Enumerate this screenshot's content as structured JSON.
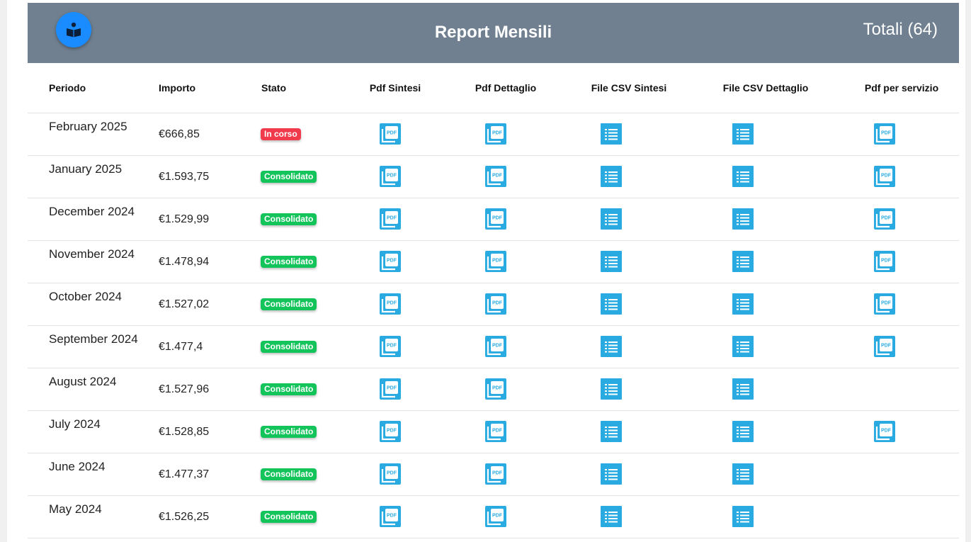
{
  "header": {
    "title": "Report Mensili",
    "totals": "Totali (64)",
    "logo_icon": "reader-book-icon",
    "color": "#708090"
  },
  "columns": {
    "period": "Periodo",
    "amount": "Importo",
    "status": "Stato",
    "pdf_summary": "Pdf Sintesi",
    "pdf_detail": "Pdf Dettaglio",
    "csv_summary": "File CSV Sintesi",
    "csv_detail": "File CSV Dettaglio",
    "pdf_service": "Pdf per servizio"
  },
  "icons": {
    "pdf": "pdf-file-icon",
    "csv": "list-file-icon",
    "color": "#29abe2"
  },
  "status_colors": {
    "In corso": "#f23a4d",
    "Consolidato": "#13c45a"
  },
  "rows": [
    {
      "period": "February 2025",
      "amount": "€666,85",
      "status": "In corso",
      "pdf_service": true
    },
    {
      "period": "January 2025",
      "amount": "€1.593,75",
      "status": "Consolidato",
      "pdf_service": true
    },
    {
      "period": "December 2024",
      "amount": "€1.529,99",
      "status": "Consolidato",
      "pdf_service": true
    },
    {
      "period": "November 2024",
      "amount": "€1.478,94",
      "status": "Consolidato",
      "pdf_service": true
    },
    {
      "period": "October 2024",
      "amount": "€1.527,02",
      "status": "Consolidato",
      "pdf_service": true
    },
    {
      "period": "September 2024",
      "amount": "€1.477,4",
      "status": "Consolidato",
      "pdf_service": true
    },
    {
      "period": "August 2024",
      "amount": "€1.527,96",
      "status": "Consolidato",
      "pdf_service": false
    },
    {
      "period": "July 2024",
      "amount": "€1.528,85",
      "status": "Consolidato",
      "pdf_service": true
    },
    {
      "period": "June 2024",
      "amount": "€1.477,37",
      "status": "Consolidato",
      "pdf_service": false
    },
    {
      "period": "May 2024",
      "amount": "€1.526,25",
      "status": "Consolidato",
      "pdf_service": false
    }
  ]
}
